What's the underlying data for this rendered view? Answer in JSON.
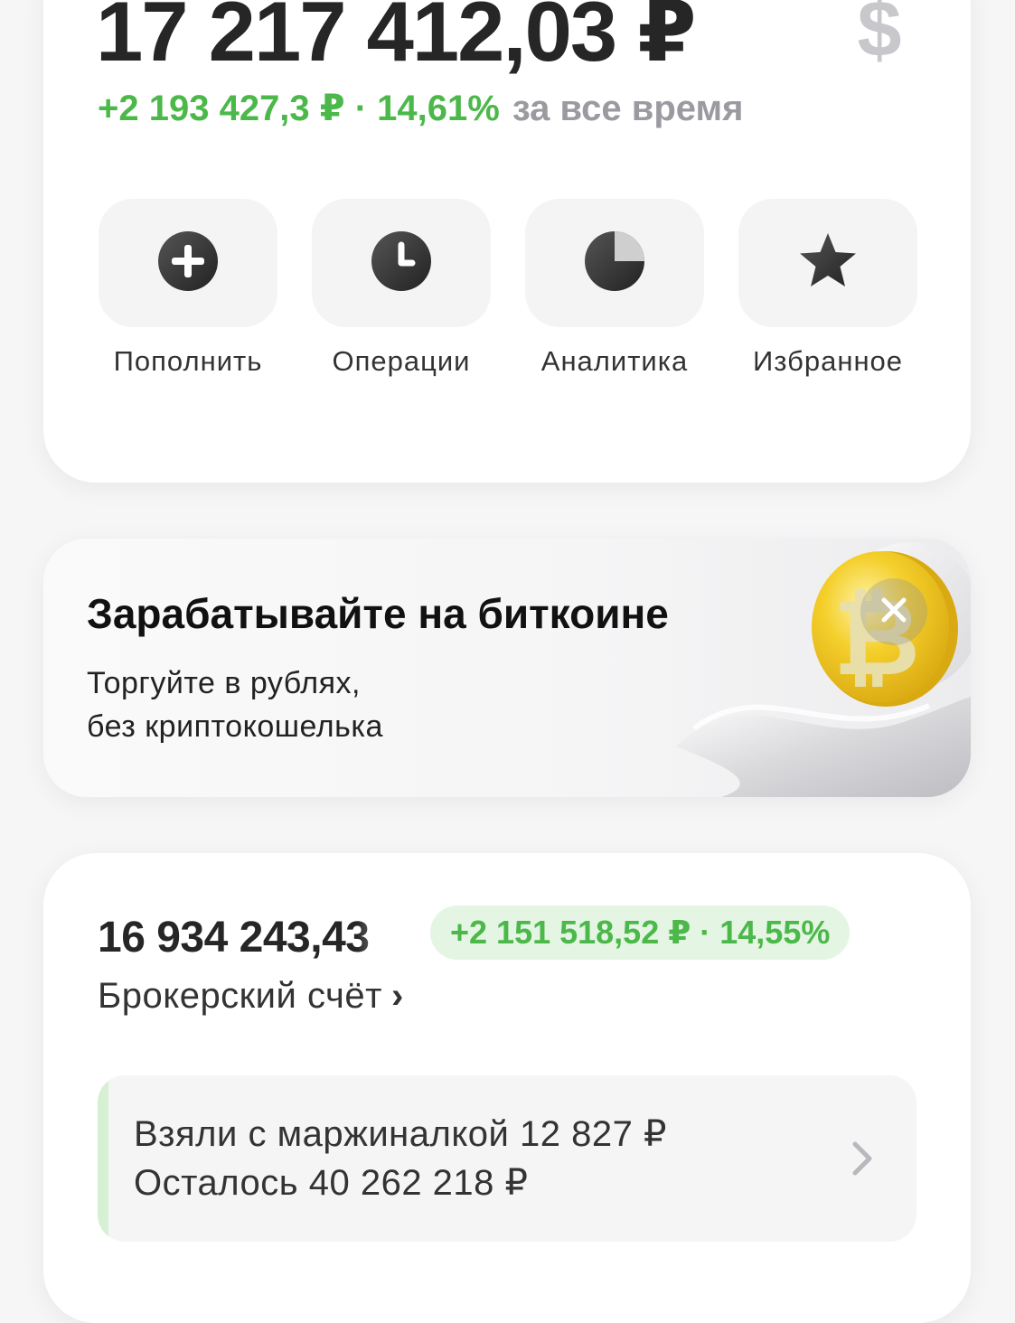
{
  "portfolio": {
    "total": "17 217 412,03 ₽",
    "currency_switch": "$",
    "gain": "+2 193 427,3 ₽ · 14,61%",
    "period": "за все время"
  },
  "actions": [
    {
      "label": "Пополнить",
      "icon": "plus-icon"
    },
    {
      "label": "Операции",
      "icon": "clock-icon"
    },
    {
      "label": "Аналитика",
      "icon": "pie-chart-icon"
    },
    {
      "label": "Избранное",
      "icon": "star-icon"
    }
  ],
  "promo": {
    "title": "Зарабатывайте на биткоине",
    "subtitle_line1": "Торгуйте в рублях,",
    "subtitle_line2": "без криптокошелька"
  },
  "broker": {
    "value": "16 934 243,43",
    "gain": "+2 151 518,52 ₽ · 14,55%",
    "title": "Брокерский счёт",
    "chevron": "›",
    "margin_line1": "Взяли с маржиналкой 12 827 ₽",
    "margin_line2": "Осталось 40 262 218 ₽"
  },
  "colors": {
    "positive": "#4cb84a",
    "positive_bg": "#e4f5e3",
    "muted": "#9a9aa0",
    "coin": "#f2c81f"
  }
}
